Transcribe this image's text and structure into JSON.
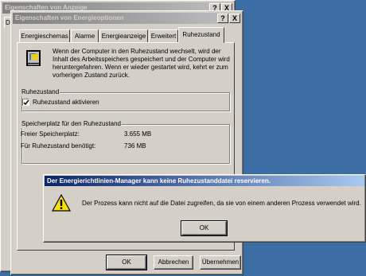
{
  "back_window": {
    "title": "Eigenschaften von Anzeige",
    "help_btn": "?",
    "close_btn": "X",
    "clipped_tab": "D"
  },
  "power_window": {
    "title": "Eigenschaften von Energieoptionen",
    "help_btn": "?",
    "close_btn": "X",
    "tabs": [
      "Energieschemas",
      "Alarme",
      "Energieanzeige",
      "Erweitert",
      "Ruhezustand"
    ],
    "description": "Wenn der Computer in den Ruhezustand wechselt, wird der Inhalt des Arbeitsspeichers gespeichert und der Computer wird heruntergefahren. Wenn er wieder gestartet wird, kehrt er zum vorherigen Zustand zurück.",
    "hibernate_group": {
      "label": "Ruhezustand",
      "checkbox_label": "Ruhezustand aktivieren",
      "checked": true
    },
    "space_group": {
      "label": "Speicherplatz für den Ruhezustand",
      "free_label": "Freier Speicherplatz:",
      "free_value": "3.655 MB",
      "needed_label": "Für Ruhezustand benötigt:",
      "needed_value": "736 MB"
    },
    "buttons": {
      "ok": "OK",
      "cancel": "Abbrechen",
      "apply": "Übernehmen"
    }
  },
  "error_dialog": {
    "title": "Der Energierichtlinien-Manager kann keine Ruhezustanddatei reservieren.",
    "message": "Der Prozess kann nicht auf die Datei zugreifen, da sie von einem anderen Prozess verwendet wird.",
    "ok": "OK",
    "icon": "warning-icon"
  }
}
